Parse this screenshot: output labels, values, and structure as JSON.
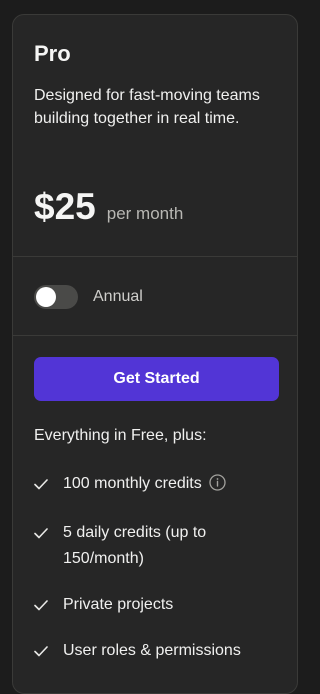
{
  "plan": {
    "name": "Pro",
    "description": "Designed for fast-moving teams building together in real time.",
    "price": "$25",
    "price_period": "per month"
  },
  "billing_toggle": {
    "label": "Annual",
    "on": false
  },
  "cta": {
    "label": "Get Started",
    "color": "#5235d6"
  },
  "features": {
    "intro": "Everything in Free, plus:",
    "items": [
      {
        "label": "100 monthly credits",
        "icon": "check-icon",
        "info_icon": "info-icon"
      },
      {
        "label": "5 daily credits (up to 150/month)",
        "icon": "check-icon"
      },
      {
        "label": "Private projects",
        "icon": "check-icon"
      },
      {
        "label": "User roles & permissions",
        "icon": "check-icon"
      }
    ]
  }
}
